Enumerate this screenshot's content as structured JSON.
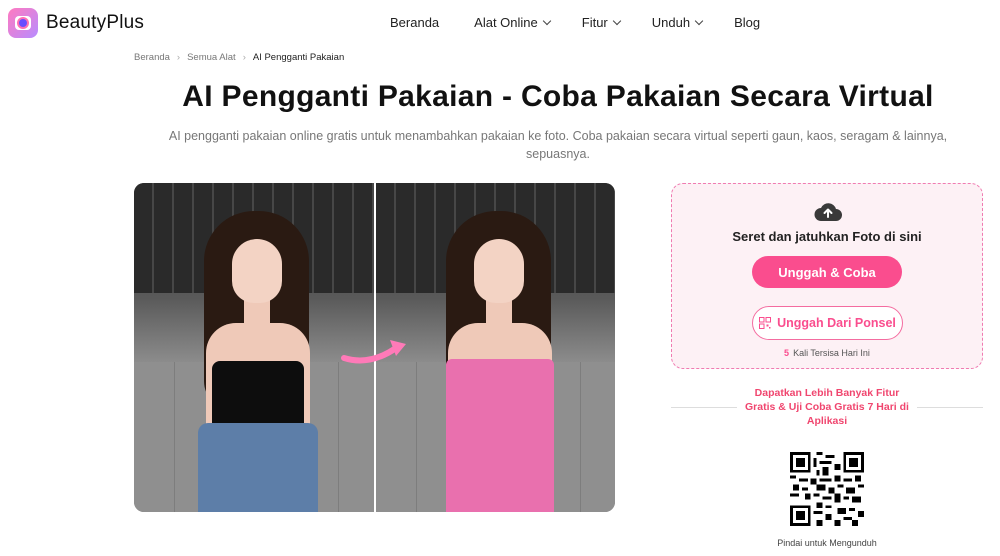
{
  "header": {
    "brand": "BeautyPlus",
    "nav": [
      {
        "label": "Beranda",
        "has_dropdown": false
      },
      {
        "label": "Alat Online",
        "has_dropdown": true
      },
      {
        "label": "Fitur",
        "has_dropdown": true
      },
      {
        "label": "Unduh",
        "has_dropdown": true
      },
      {
        "label": "Blog",
        "has_dropdown": false
      }
    ]
  },
  "breadcrumb": [
    "Beranda",
    "Semua Alat",
    "AI Pengganti Pakaian"
  ],
  "page": {
    "title": "AI Pengganti Pakaian - Coba Pakaian Secara Virtual",
    "subtitle": "AI pengganti pakaian online gratis untuk menambahkan pakaian ke foto. Coba pakaian secara virtual seperti gaun, kaos, seragam & lainnya, sepuasnya."
  },
  "upload": {
    "drop_text": "Seret dan jatuhkan Foto di sini",
    "primary_button": "Unggah & Coba",
    "phone_button": "Unggah Dari Ponsel",
    "remaining_count": "5",
    "remaining_text": "Kali Tersisa Hari Ini"
  },
  "promo": {
    "text": "Dapatkan Lebih Banyak Fitur Gratis & Uji Coba Gratis 7 Hari di Aplikasi"
  },
  "qr": {
    "caption": "Pindai untuk Mengunduh"
  },
  "colors": {
    "accent": "#fa4d8e",
    "card_bg": "#fdf1f5",
    "promo_text": "#f0466f"
  },
  "icons": [
    "cloud-upload-icon",
    "qr-code-icon",
    "chevron-down-icon",
    "arrow-icon"
  ]
}
